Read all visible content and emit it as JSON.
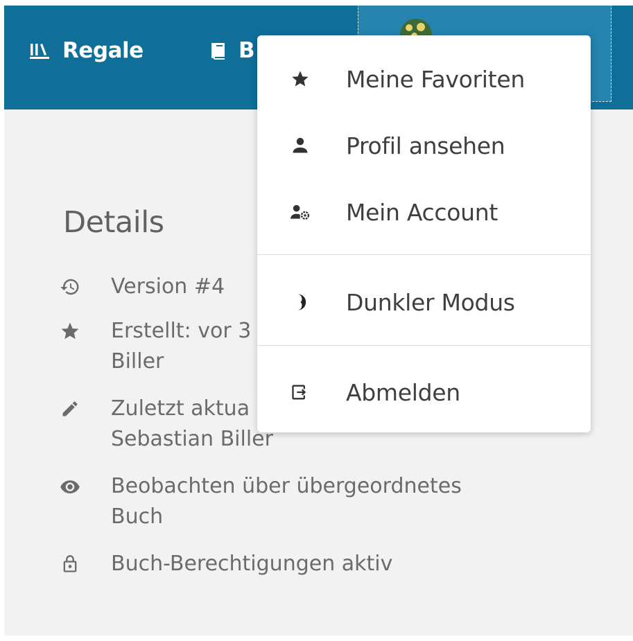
{
  "header": {
    "nav": [
      {
        "label": "Regale",
        "icon": "shelves-icon"
      },
      {
        "label": "B",
        "icon": "books-icon"
      }
    ],
    "user": {
      "avatar": "avatar-image"
    }
  },
  "details": {
    "title": "Details",
    "items": [
      {
        "icon": "history-icon",
        "text": "Version #4"
      },
      {
        "icon": "star-icon",
        "text": "Erstellt: vor 3\nBiller"
      },
      {
        "icon": "pencil-icon",
        "text": "Zuletzt aktua\nSebastian Biller"
      },
      {
        "icon": "eye-icon",
        "text": "Beobachten über übergeordnetes\nBuch"
      },
      {
        "icon": "lock-icon",
        "text": "Buch-Berechtigungen aktiv"
      }
    ]
  },
  "user_menu": {
    "items": [
      {
        "label": "Meine Favoriten",
        "icon": "star-icon"
      },
      {
        "label": "Profil ansehen",
        "icon": "user-icon"
      },
      {
        "label": "Mein Account",
        "icon": "user-settings-icon"
      },
      {
        "label": "Dunkler Modus",
        "icon": "half-moon-icon"
      },
      {
        "label": "Abmelden",
        "icon": "logout-icon"
      }
    ]
  },
  "colors": {
    "header_bg": "#0f6f99",
    "user_area_bg": "#2583ad",
    "page_bg": "#f2f2f2",
    "menu_text": "#3f3f3f",
    "detail_text": "#6b6b6b"
  }
}
